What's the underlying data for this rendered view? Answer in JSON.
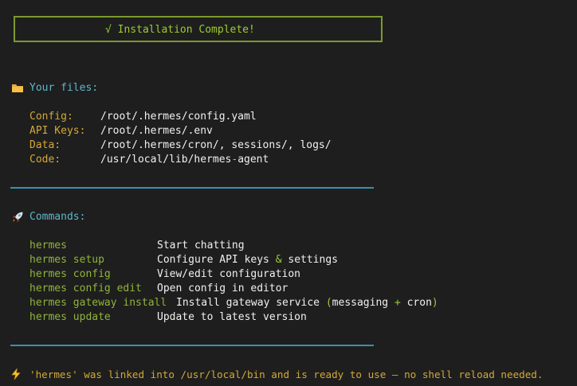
{
  "banner": {
    "text": "√ Installation Complete!"
  },
  "files": {
    "heading": "Your files:",
    "rows": [
      {
        "label": "Config:",
        "value": "/root/.hermes/config.yaml"
      },
      {
        "label": "API Keys:",
        "value": "/root/.hermes/.env"
      },
      {
        "label": "Data:",
        "value": "/root/.hermes/cron/, sessions/, logs/"
      },
      {
        "label": "Code:",
        "value_a": "/usr/local/lib/hermes",
        "value_dash": "-",
        "value_b": "agent"
      }
    ]
  },
  "commands": {
    "heading": "Commands:",
    "rows": [
      {
        "cmd": "hermes",
        "desc": "Start chatting"
      },
      {
        "cmd": "hermes setup",
        "desc_a": "Configure API keys ",
        "desc_amp": "&",
        "desc_b": " settings"
      },
      {
        "cmd": "hermes config",
        "desc": "View/edit configuration"
      },
      {
        "cmd": "hermes config edit",
        "desc": "Open config in editor"
      },
      {
        "cmd": "hermes gateway install",
        "desc_a": "Install gateway service ",
        "desc_p1": "(",
        "desc_b": "messaging ",
        "desc_plus": "+",
        "desc_c": " cron",
        "desc_p2": ")"
      },
      {
        "cmd": "hermes update",
        "desc": "Update to latest version"
      }
    ]
  },
  "notice": {
    "text": "'hermes' was linked into /usr/local/bin and is ready to use — no shell reload needed."
  },
  "colors": {
    "background": "#1e1e1e",
    "banner_border": "#7c9a2e",
    "banner_text": "#9acd32",
    "heading": "#5fb7c9",
    "label": "#d4a838",
    "command": "#8fb43a",
    "rule": "#3a8fb3"
  },
  "icons": {
    "files": "folder-icon",
    "commands": "rocket-icon",
    "notice": "lightning-icon"
  }
}
